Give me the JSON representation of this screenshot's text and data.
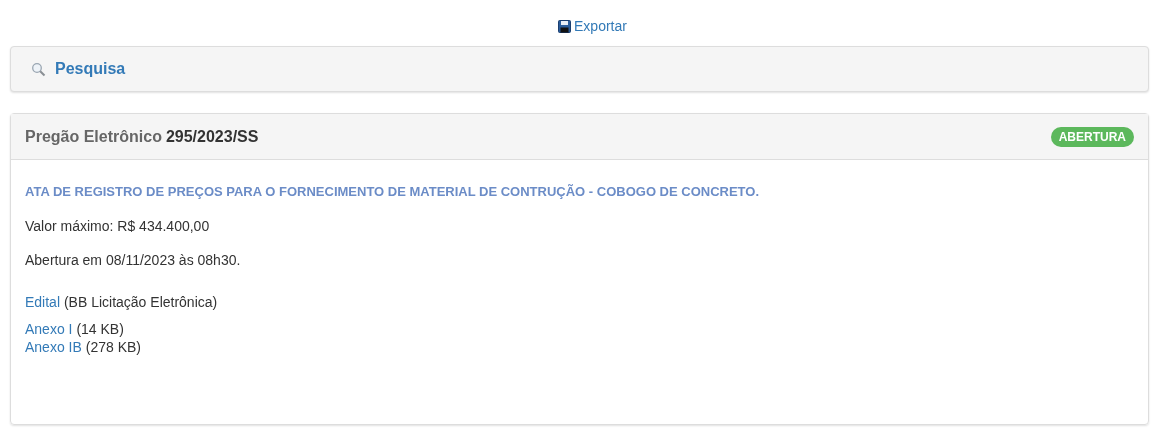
{
  "export_link": "Exportar",
  "search_panel": {
    "title": "Pesquisa"
  },
  "tender": {
    "type": "Pregão Eletrônico",
    "number": "295/2023/SS",
    "status": "ABERTURA",
    "object": "ATA DE REGISTRO DE PREÇOS PARA O FORNECIMENTO DE MATERIAL DE CONTRUÇÃO - COBOGO DE CONCRETO.",
    "max_value": "Valor máximo: R$ 434.400,00",
    "opening": "Abertura em 08/11/2023 às 08h30.",
    "notice": {
      "link": "Edital",
      "note": "(BB Licitação Eletrônica)"
    },
    "attachments": [
      {
        "link": "Anexo I",
        "size": "(14 KB)"
      },
      {
        "link": "Anexo IB",
        "size": "(278 KB)"
      }
    ]
  }
}
